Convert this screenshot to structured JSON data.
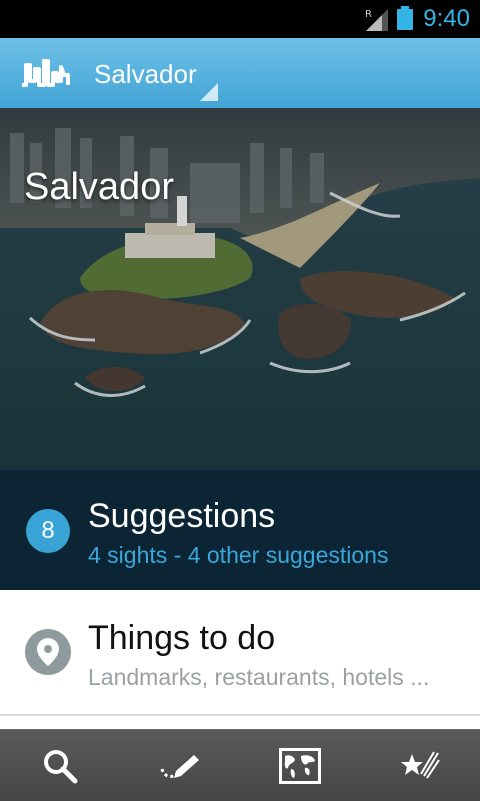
{
  "status": {
    "time": "9:40",
    "signal_label": "R",
    "accent": "#33b5e5"
  },
  "header": {
    "title": "Salvador",
    "logo_icon": "city-skyline-icon"
  },
  "hero": {
    "caption": "Salvador"
  },
  "suggestions": {
    "count": "8",
    "title": "Suggestions",
    "subtitle": "4 sights - 4 other suggestions"
  },
  "things_to_do": {
    "title": "Things to do",
    "subtitle": "Landmarks, restaurants, hotels ..."
  },
  "bottom_nav": [
    {
      "icon": "search-icon"
    },
    {
      "icon": "trip-planner-pencil-icon"
    },
    {
      "icon": "world-map-icon"
    },
    {
      "icon": "favorites-stars-icon"
    }
  ],
  "colors": {
    "action_bar": "#42a4d6",
    "suggestions_bg": "#0c2535",
    "badge": "#3aa3d5",
    "pin": "#8f9a9f"
  }
}
